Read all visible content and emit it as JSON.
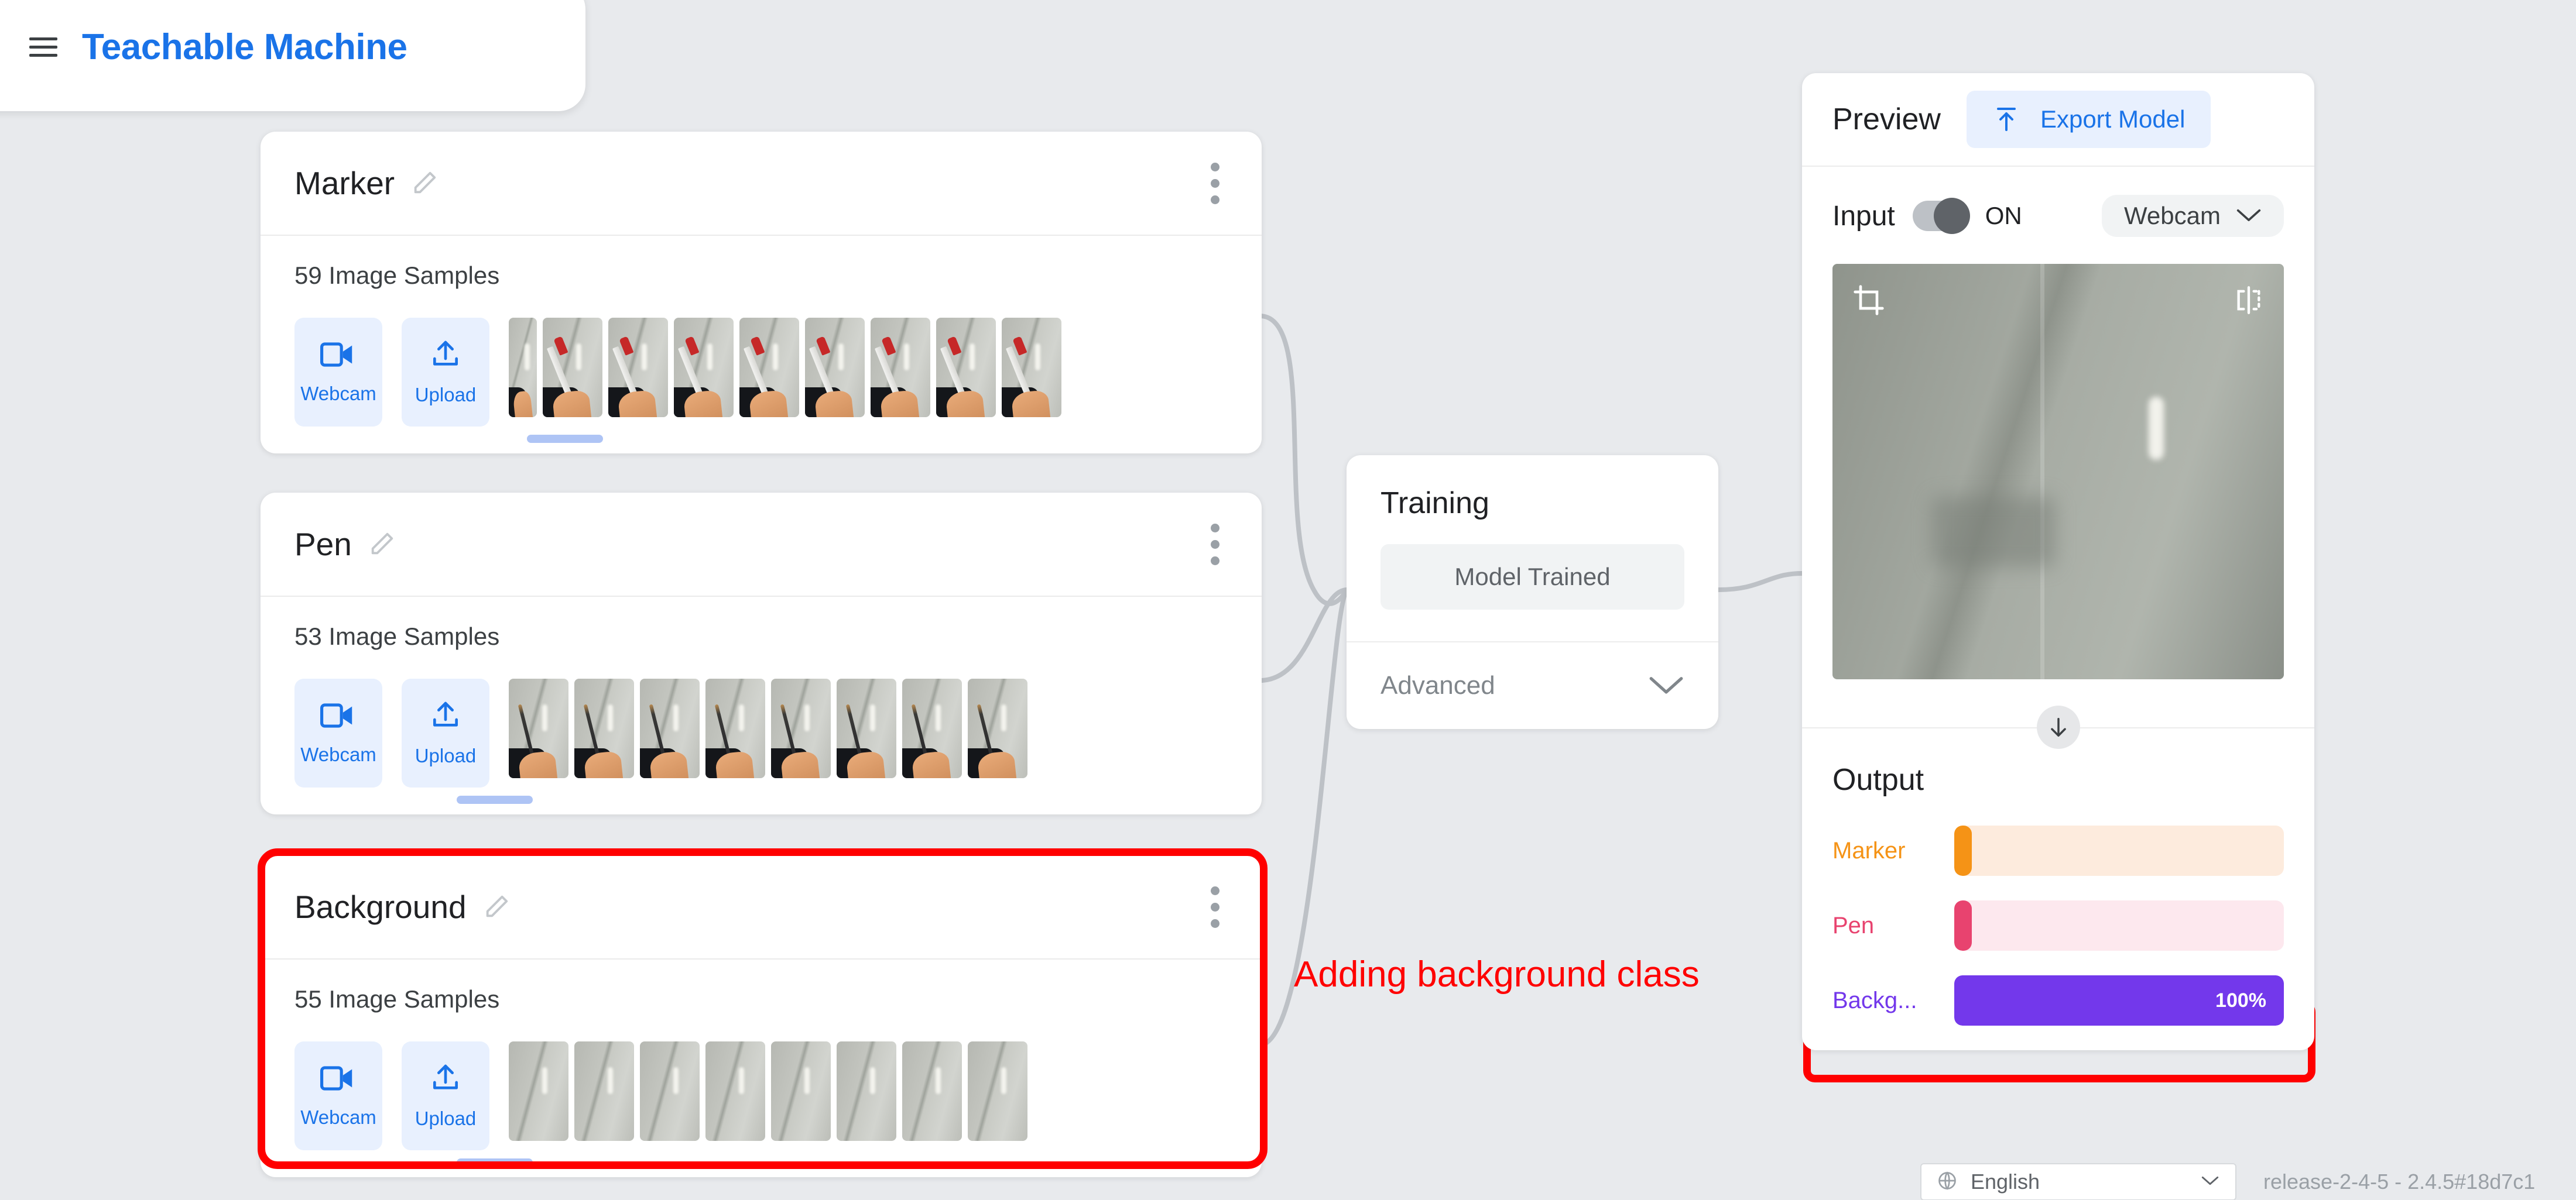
{
  "header": {
    "brand": "Teachable Machine",
    "menu_icon": "hamburger-menu-icon"
  },
  "classes": [
    {
      "name": "Marker",
      "samples_label": "59 Image Samples",
      "sample_count": 59,
      "webcam_label": "Webcam",
      "upload_label": "Upload",
      "highlighted": false
    },
    {
      "name": "Pen",
      "samples_label": "53 Image Samples",
      "sample_count": 53,
      "webcam_label": "Webcam",
      "upload_label": "Upload",
      "highlighted": false
    },
    {
      "name": "Background",
      "samples_label": "55 Image Samples",
      "sample_count": 55,
      "webcam_label": "Webcam",
      "upload_label": "Upload",
      "highlighted": true
    }
  ],
  "training": {
    "title": "Training",
    "trained_button_label": "Model Trained",
    "advanced_label": "Advanced",
    "advanced_chevron_icon": "chevron-down-icon"
  },
  "preview": {
    "title": "Preview",
    "export_label": "Export Model",
    "export_icon": "upload-model-icon",
    "input_label": "Input",
    "toggle_state_label": "ON",
    "source_label": "Webcam",
    "source_chevron_icon": "chevron-down-icon",
    "crop_icon": "crop-icon",
    "flip_icon": "flip-horizontal-icon",
    "collapse_icon": "arrow-down-icon",
    "output_title": "Output",
    "predictions": [
      {
        "label": "Marker",
        "percent_label": "",
        "percent": 0,
        "color": "#f59316",
        "track": "#fdebdd",
        "fill": "#f59316"
      },
      {
        "label": "Pen",
        "percent_label": "",
        "percent": 0,
        "color": "#e8436f",
        "track": "#fde8ee",
        "fill": "#e8436f"
      },
      {
        "label": "Backg...",
        "percent_label": "100%",
        "percent": 100,
        "color": "#7338eb",
        "track": "#ece2fd",
        "fill": "#7338eb"
      }
    ]
  },
  "annotation": {
    "text": "Adding background class",
    "color": "#ff0000"
  },
  "footer": {
    "globe_icon": "globe-icon",
    "language": "English",
    "language_chevron_icon": "chevron-down-icon",
    "version": "release-2-4-5 - 2.4.5#18d7c1"
  }
}
